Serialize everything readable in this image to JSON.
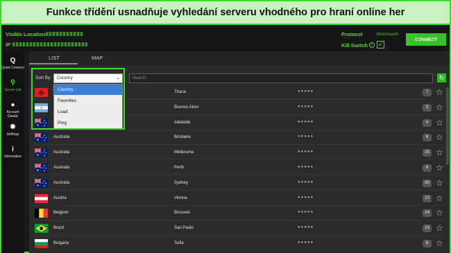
{
  "banner": {
    "text": "Funkce třídění usnadňuje vyhledání serveru vhodného pro hraní online her"
  },
  "header": {
    "visible_location_label": "Visible Location",
    "ip_label": "IP",
    "protocol_label": "Protocol",
    "protocol_value": "WireGuard",
    "kill_switch_label": "Kill Switch",
    "info_icon": "i",
    "checkbox_mark": "✓",
    "connect_label": "CONNECT"
  },
  "sidebar": {
    "items": [
      {
        "label": "Quick Connect",
        "icon": "Q"
      },
      {
        "label": "Server List",
        "icon": "⚲"
      },
      {
        "label": "Account Details",
        "icon": "●"
      },
      {
        "label": "Settings",
        "icon": "✹"
      },
      {
        "label": "Information",
        "icon": "i"
      }
    ]
  },
  "tabs": {
    "list": "LIST",
    "map": "MAP"
  },
  "toolbar": {
    "sort_by_label": "Sort By:",
    "sort_value": "Country",
    "chevron": "⌄",
    "search_placeholder": "Search",
    "refresh_icon": "↻"
  },
  "dropdown": {
    "options": [
      "Country",
      "Favorites",
      "Load",
      "Ping"
    ],
    "selected": "Country"
  },
  "servers": [
    {
      "country": "Albania",
      "city": "Tirana",
      "ping": "●●●●●",
      "load": "7",
      "flag": "albania"
    },
    {
      "country": "Argentina",
      "city": "Buenos Aires",
      "ping": "●●●●●",
      "load": "3",
      "flag": "argentina"
    },
    {
      "country": "Australia",
      "city": "Adelaide",
      "ping": "●●●●●",
      "load": "4",
      "flag": "australia"
    },
    {
      "country": "Australia",
      "city": "Brisbane",
      "ping": "●●●●●",
      "load": "6",
      "flag": "australia"
    },
    {
      "country": "Australia",
      "city": "Melbourne",
      "ping": "●●●●●",
      "load": "23",
      "flag": "australia"
    },
    {
      "country": "Australia",
      "city": "Perth",
      "ping": "●●●●●",
      "load": "6",
      "flag": "australia"
    },
    {
      "country": "Australia",
      "city": "Sydney",
      "ping": "●●●●●",
      "load": "30",
      "flag": "australia"
    },
    {
      "country": "Austria",
      "city": "Vienna",
      "ping": "●●●●●",
      "load": "13",
      "flag": "austria"
    },
    {
      "country": "Belgium",
      "city": "Brussels",
      "ping": "●●●●●",
      "load": "14",
      "flag": "belgium"
    },
    {
      "country": "Brazil",
      "city": "Sao Paulo",
      "ping": "●●●●●",
      "load": "13",
      "flag": "brazil"
    },
    {
      "country": "Bulgaria",
      "city": "Sofia",
      "ping": "●●●●●",
      "load": "6",
      "flag": "bulgaria"
    }
  ],
  "colors": {
    "accent": "#3adb2b",
    "background": "#2b2b2b",
    "sidebar": "#121212",
    "banner": "#c6f3c0"
  }
}
